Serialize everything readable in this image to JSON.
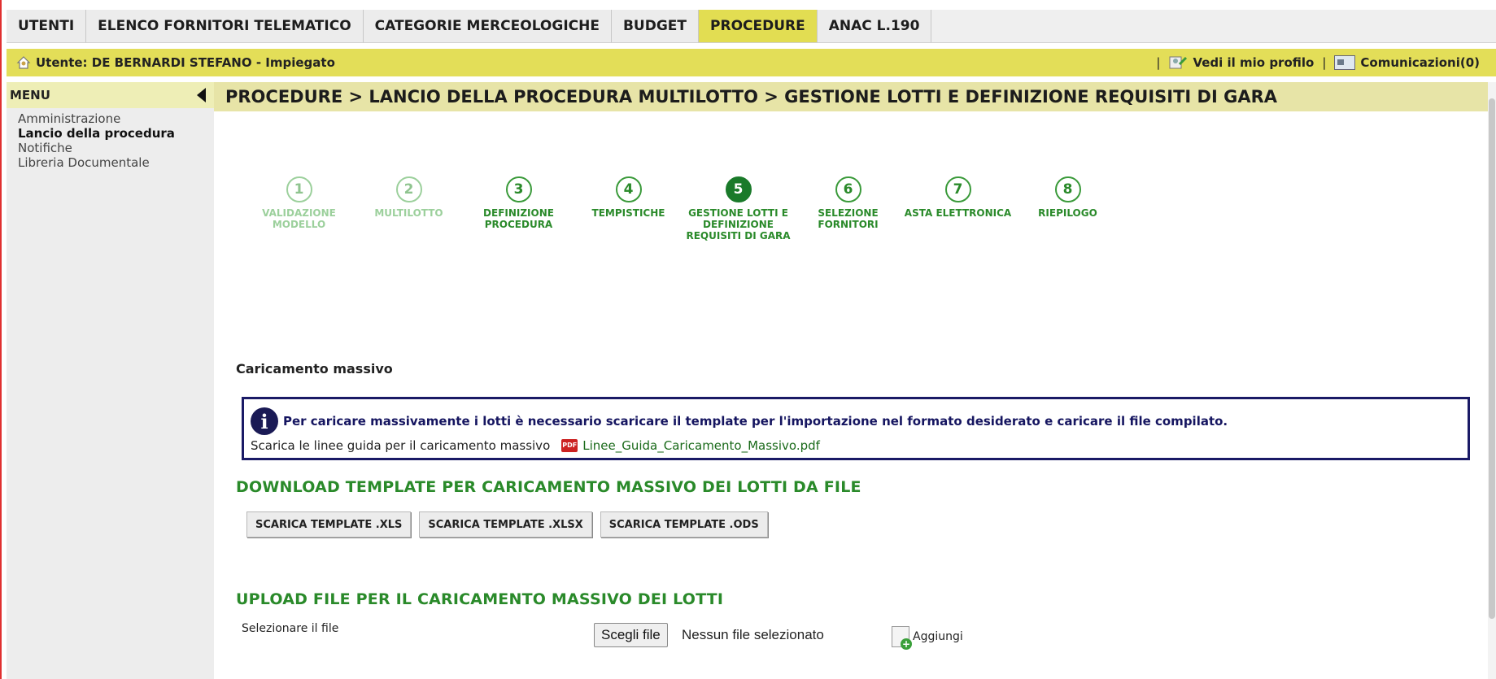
{
  "tabs": [
    {
      "label": "UTENTI"
    },
    {
      "label": "ELENCO FORNITORI TELEMATICO"
    },
    {
      "label": "CATEGORIE MERCEOLOGICHE"
    },
    {
      "label": "BUDGET"
    },
    {
      "label": "PROCEDURE",
      "active": true
    },
    {
      "label": "ANAC L.190"
    }
  ],
  "userbar": {
    "user": "Utente: DE BERNARDI STEFANO - Impiegato",
    "separator": "|",
    "profile": "Vedi il mio profilo",
    "messages": "Comunicazioni(0)"
  },
  "menu": {
    "title": "MENU",
    "items": [
      "Amministrazione",
      "Lancio della procedura",
      "Notifiche",
      "Libreria Documentale"
    ]
  },
  "breadcrumb": "PROCEDURE  > LANCIO DELLA PROCEDURA MULTILOTTO  > GESTIONE LOTTI E DEFINIZIONE REQUISITI DI GARA",
  "steps": [
    {
      "num": "1",
      "label": "VALIDAZIONE MODELLO",
      "state": "done"
    },
    {
      "num": "2",
      "label": "MULTILOTTO",
      "state": "done"
    },
    {
      "num": "3",
      "label": "DEFINIZIONE PROCEDURA",
      "state": "todo"
    },
    {
      "num": "4",
      "label": "TEMPISTICHE",
      "state": "todo"
    },
    {
      "num": "5",
      "label": "GESTIONE LOTTI E DEFINIZIONE REQUISITI DI GARA",
      "state": "current"
    },
    {
      "num": "6",
      "label": "SELEZIONE FORNITORI",
      "state": "todo"
    },
    {
      "num": "7",
      "label": "ASTA ELETTRONICA",
      "state": "todo"
    },
    {
      "num": "8",
      "label": "RIEPILOGO",
      "state": "todo"
    }
  ],
  "caricamento": {
    "title": "Caricamento massivo",
    "info": "Per caricare massivamente i lotti è necessario scaricare il template per l'importazione nel formato desiderato e caricare il file compilato.",
    "guide_text": "Scarica le linee guida per il caricamento massivo",
    "pdf_icon": "PDF",
    "pdf_link": "Linee_Guida_Caricamento_Massivo.pdf"
  },
  "download": {
    "title": "DOWNLOAD TEMPLATE PER CARICAMENTO MASSIVO DEI LOTTI DA FILE",
    "buttons": [
      "SCARICA TEMPLATE .XLS",
      "SCARICA TEMPLATE .XLSX",
      "SCARICA TEMPLATE .ODS"
    ]
  },
  "upload": {
    "title": "UPLOAD FILE PER IL CARICAMENTO MASSIVO DEI LOTTI",
    "field_label": "Selezionare il file",
    "choose": "Scegli file",
    "nofile": "Nessun file selezionato",
    "add": "Aggiungi"
  },
  "colors": {
    "accent": "#e3de58",
    "green": "#2a8a2a",
    "info_border": "#1a1a66"
  }
}
